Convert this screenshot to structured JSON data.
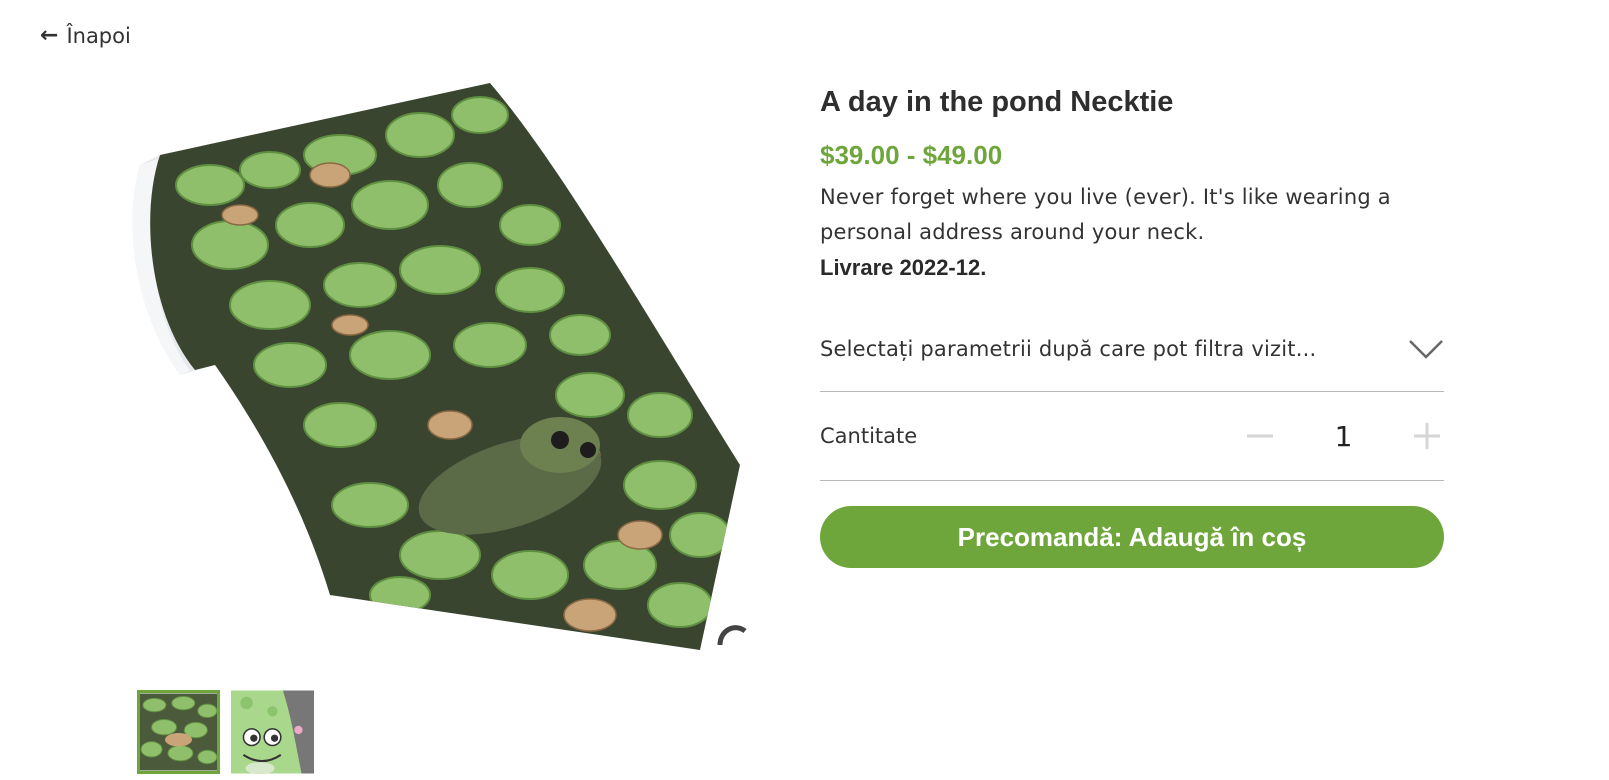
{
  "nav": {
    "back_label": "Înapoi"
  },
  "product": {
    "title": "A day in the pond Necktie",
    "price": "$39.00 - $49.00",
    "description": "Never forget where you live (ever). It's like wearing a personal address around your neck.",
    "delivery": "Livrare 2022-12."
  },
  "options": {
    "select_placeholder": "Selectați parametrii după care pot filtra vizit..."
  },
  "quantity": {
    "label": "Cantitate",
    "value": "1"
  },
  "cta": {
    "label": "Precomandă: Adaugă în coș"
  },
  "gallery": {
    "images": [
      "frog-pond-tie",
      "cartoon-frog-tie"
    ],
    "selected_index": 0
  },
  "colors": {
    "accent": "#6fa63c",
    "divider": "#b8b8b8",
    "text": "#333333"
  },
  "icons": {
    "back": "arrow-left-icon",
    "dropdown": "chevron-down-icon",
    "decrement": "minus-icon",
    "increment": "plus-icon"
  }
}
